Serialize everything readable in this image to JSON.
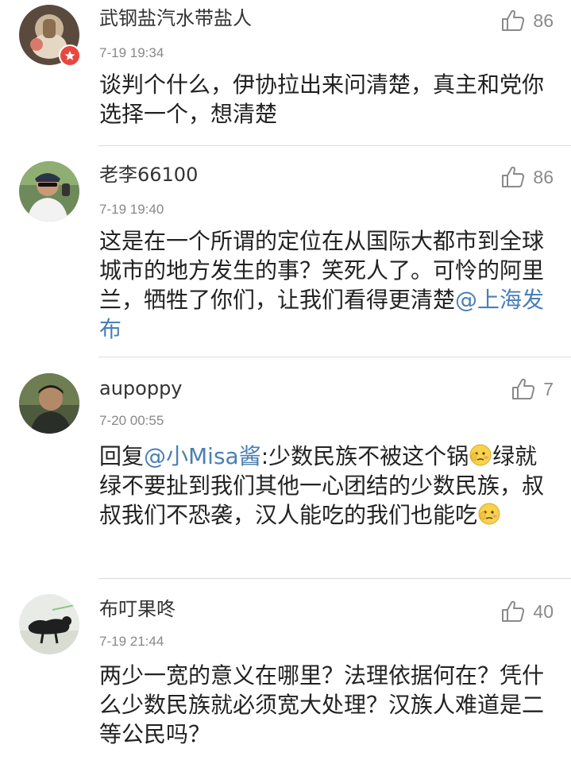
{
  "comments": [
    {
      "username": "武钢盐汽水带盐人",
      "time": "7-19 19:34",
      "likes": "86",
      "text": "谈判个什么，伊协拉出来问清楚，真主和党你选择一个，想清楚",
      "has_badge": true
    },
    {
      "username": "老李66100",
      "time": "7-19 19:40",
      "likes": "86",
      "text_before": "这是在一个所谓的定位在从国际大都市到全球城市的地方发生的事？笑死人了。可怜的阿里兰，牺牲了你们，让我们看得更清楚",
      "mention": "@上海发布"
    },
    {
      "username": "aupoppy",
      "time": "7-20 00:55",
      "likes": "7",
      "reply_prefix": "回复",
      "mention": "@小Misa酱",
      "text_part1": ":少数民族不被这个锅",
      "text_part2": "绿就绿不要扯到我们其他一心团结的少数民族，叔叔我们不恐袭，汉人能吃的我们也能吃",
      "emoji": "shy-face-emoji"
    },
    {
      "username": "布叮果咚",
      "time": "7-19 21:44",
      "likes": "40",
      "text": "两少一宽的意义在哪里？法理依据何在？凭什么少数民族就必须宽大处理？汉族人难道是二等公民吗？"
    }
  ],
  "colors": {
    "mention": "#4a7fb5",
    "badge": "#e8473f",
    "meta": "#888888"
  },
  "icons": [
    "thumbs-up-icon",
    "v-badge-icon",
    "shy-face-emoji"
  ]
}
